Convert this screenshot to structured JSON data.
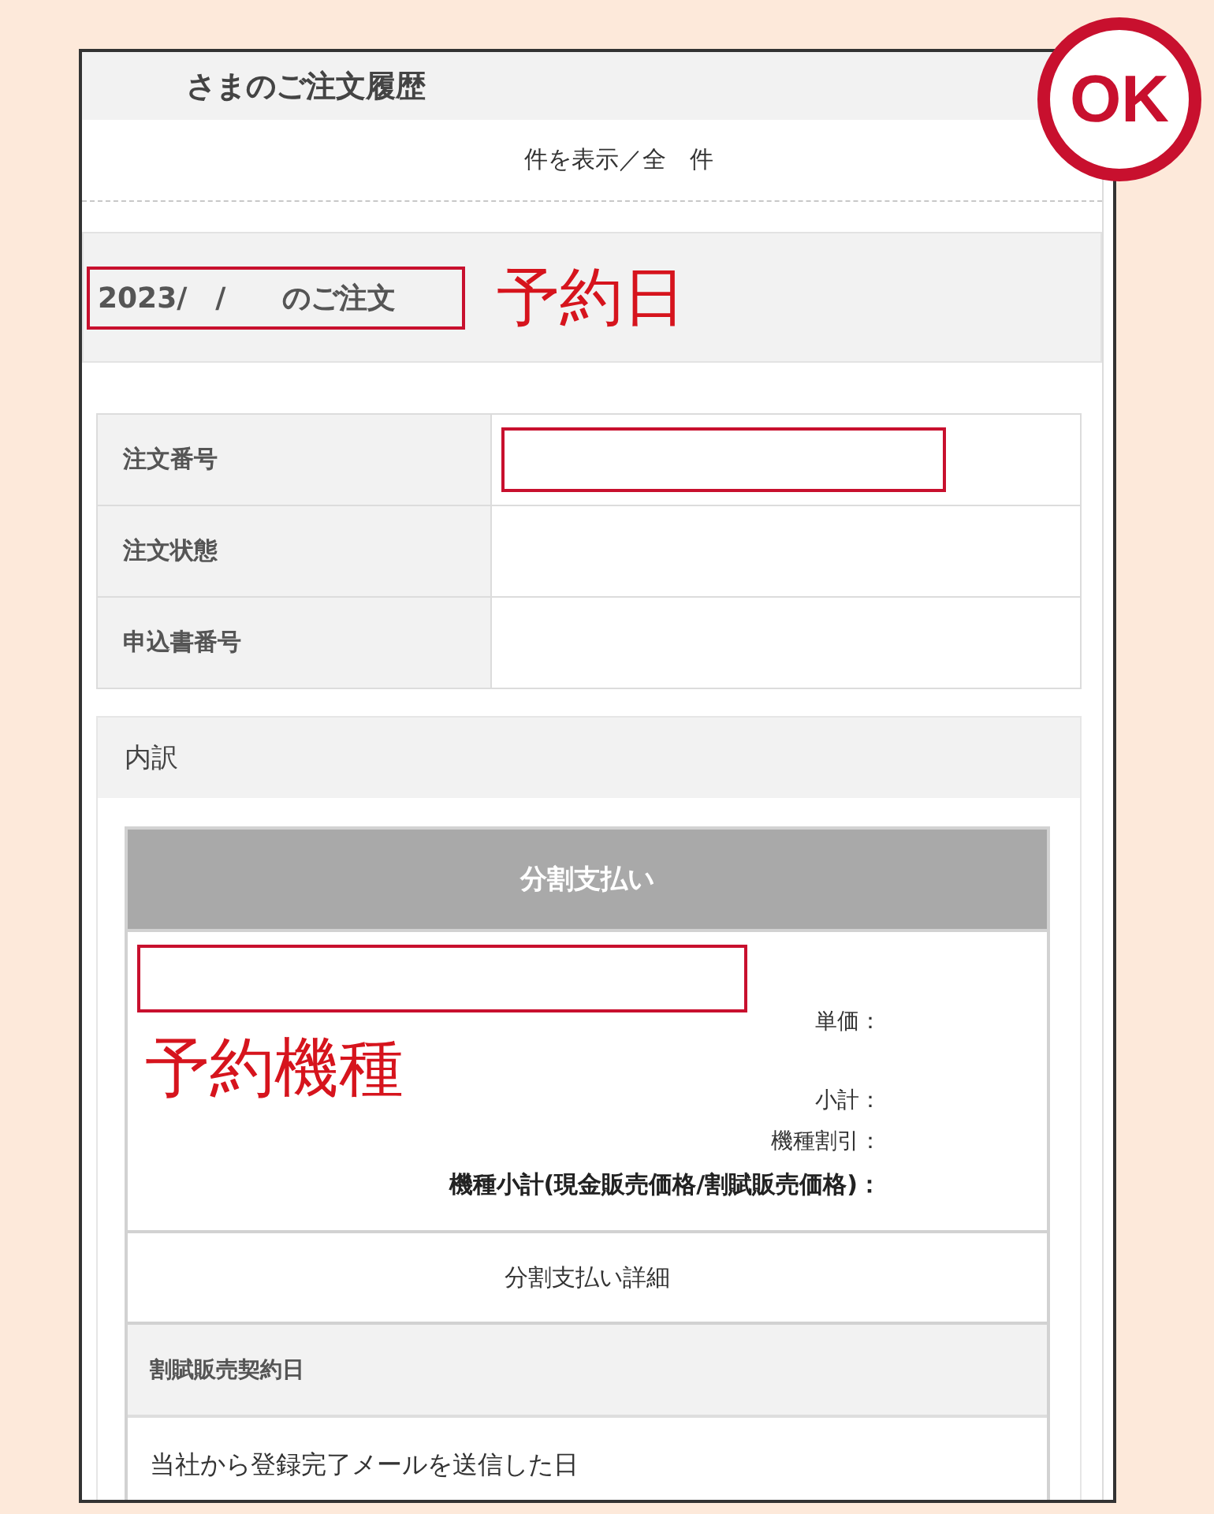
{
  "stamp": {
    "text": "OK"
  },
  "header": {
    "title": "さまのご注文履歴",
    "count_summary": "件を表示／全　件"
  },
  "order": {
    "heading": "2023/　/　　のご注文",
    "heading_highlighted": true,
    "annotation": "予約日",
    "details": [
      {
        "label": "注文番号",
        "highlighted": true
      },
      {
        "label": "注文状態",
        "highlighted": false
      },
      {
        "label": "申込書番号",
        "highlighted": false
      }
    ]
  },
  "breakdown": {
    "heading": "内訳",
    "card": {
      "title": "分割支払い",
      "model_highlighted": true,
      "annotation": "予約機種",
      "price_lines": [
        {
          "label": "単価：",
          "kind": "item"
        },
        {
          "label": "小計：",
          "kind": "item"
        },
        {
          "label": "機種割引：",
          "kind": "item"
        },
        {
          "label": "機種小計(現金販売価格/割賦販売価格)：",
          "kind": "total"
        }
      ],
      "detail_button": "分割支払い詳細",
      "contract_label": "割賦販売契約日",
      "contract_value": "当社から登録完了メールを送信した日"
    }
  }
}
